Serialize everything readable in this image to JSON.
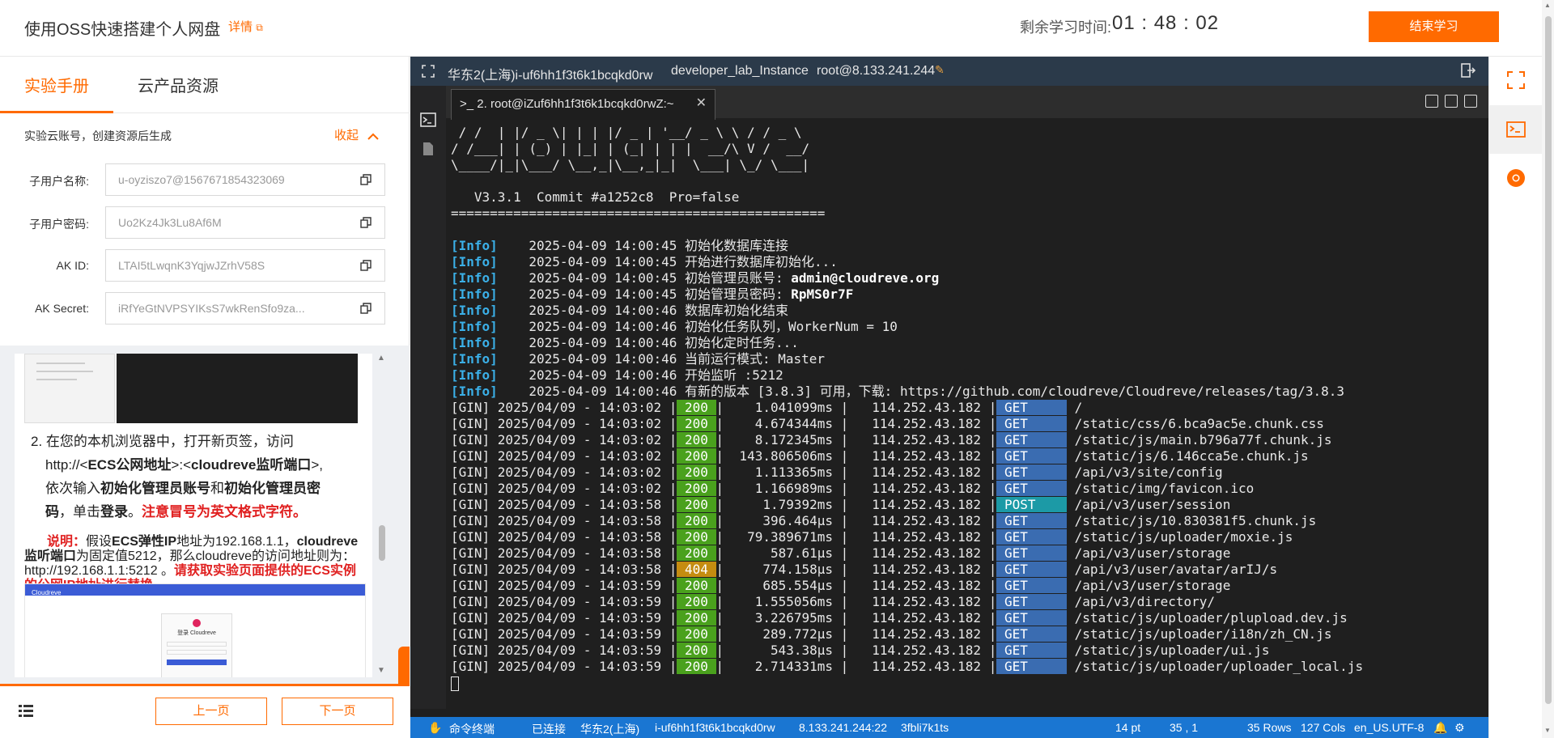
{
  "header": {
    "title": "使用OSS快速搭建个人网盘",
    "detail_link": "详情",
    "time_label": "剩余学习时间:",
    "time_value": "01 : 48 : 02",
    "end_button": "结束学习"
  },
  "left_panel": {
    "tabs": [
      {
        "label": "实验手册",
        "active": true
      },
      {
        "label": "云产品资源",
        "active": false
      }
    ],
    "account_note": "实验云账号，创建资源后生成",
    "collapse_label": "收起",
    "fields": [
      {
        "label": "子用户名称:",
        "value": "u-oyziszo7@1567671854323069"
      },
      {
        "label": "子用户密码:",
        "value": "Uo2Kz4Jk3Lu8Af6M"
      },
      {
        "label": "AK ID:",
        "value": "LTAI5tLwqnK3YqjwJZrhV58S"
      },
      {
        "label": "AK Secret:",
        "value": "iRfYeGtNVPSYIKsS7wkRenSfo9za..."
      }
    ],
    "doc": {
      "step_text_1": "2. 在您的本机浏览器中，打开新页签，访问",
      "step_text_2a": "http://<",
      "step_text_2b": "ECS公网地址",
      "step_text_2c": ">:<",
      "step_text_2d": "cloudreve监听端口",
      "step_text_2e": ">,",
      "step_text_3a": "依次输入",
      "step_text_3b": "初始化管理员账号",
      "step_text_3c": "和",
      "step_text_3d": "初始化管理员密",
      "step_text_4a": "码",
      "step_text_4b": "，单击",
      "step_text_4c": "登录",
      "step_text_4d": "。",
      "step_text_4e": "注意冒号为英文格式字符。",
      "note_label": "说明：",
      "note_text_1": "假设",
      "note_text_2": "ECS弹性IP",
      "note_text_3": "地址为192.168.1.1，",
      "note_text_4": "cloudreve监听端口",
      "note_text_5": "为固定值5212，那么cloudreve的访问地址则为：http://192.168.1.1:5212 。",
      "note_red": "请获取实验页面提供的ECS实例的公网IP地址进行替换。",
      "thumb_brand": "Cloudreve",
      "thumb_card": "登录 Cloudreve"
    },
    "prev_button": "上一页",
    "next_button": "下一页"
  },
  "terminal": {
    "top_bar": {
      "region_instance": "华东2(上海)i-uf6hh1f3t6k1bcqkd0rw",
      "lab_instance": "developer_lab_Instance",
      "login": "root@8.133.241.244"
    },
    "tab_title": ">_ 2. root@iZuf6hh1f3t6k1bcqkd0rwZ:~",
    "banner": [
      " / /  | |/ _ \\| | | |/ _ | '__/ _ \\ \\ / / _ \\",
      "/ /___| | (_) | |_| | (_| | | |  __/\\ V /  __/",
      "\\____/|_|\\___/ \\__,_|\\__,_|_|  \\___| \\_/ \\___|",
      "",
      "   V3.3.1  Commit #a1252c8  Pro=false",
      "================================================",
      ""
    ],
    "info_lines": [
      {
        "tag": "[Info]",
        "time": "2025-04-09 14:00:45",
        "msg": "初始化数据库连接",
        "hl": ""
      },
      {
        "tag": "[Info]",
        "time": "2025-04-09 14:00:45",
        "msg": "开始进行数据库初始化...",
        "hl": ""
      },
      {
        "tag": "[Info]",
        "time": "2025-04-09 14:00:45",
        "msg": "初始管理员账号: ",
        "hl": "admin@cloudreve.org"
      },
      {
        "tag": "[Info]",
        "time": "2025-04-09 14:00:45",
        "msg": "初始管理员密码: ",
        "hl": "RpMS0r7F"
      },
      {
        "tag": "[Info]",
        "time": "2025-04-09 14:00:46",
        "msg": "数据库初始化结束",
        "hl": ""
      },
      {
        "tag": "[Info]",
        "time": "2025-04-09 14:00:46",
        "msg": "初始化任务队列，WorkerNum = 10",
        "hl": ""
      },
      {
        "tag": "[Info]",
        "time": "2025-04-09 14:00:46",
        "msg": "初始化定时任务...",
        "hl": ""
      },
      {
        "tag": "[Info]",
        "time": "2025-04-09 14:00:46",
        "msg": "当前运行模式: Master",
        "hl": ""
      },
      {
        "tag": "[Info]",
        "time": "2025-04-09 14:00:46",
        "msg": "开始监听 :5212",
        "hl": ""
      },
      {
        "tag": "[Info]",
        "time": "2025-04-09 14:00:46",
        "msg": "有新的版本 [3.8.3] 可用，下载: https://github.com/cloudreve/Cloudreve/releases/tag/3.8.3",
        "hl": ""
      }
    ],
    "gin_lines": [
      {
        "date": "2025/04/09 - 14:03:02",
        "status": "200",
        "latency": "1.041099ms",
        "ip": "114.252.43.182",
        "method": "GET",
        "path": "/"
      },
      {
        "date": "2025/04/09 - 14:03:02",
        "status": "200",
        "latency": "4.674344ms",
        "ip": "114.252.43.182",
        "method": "GET",
        "path": "/static/css/6.bca9ac5e.chunk.css"
      },
      {
        "date": "2025/04/09 - 14:03:02",
        "status": "200",
        "latency": "8.172345ms",
        "ip": "114.252.43.182",
        "method": "GET",
        "path": "/static/js/main.b796a77f.chunk.js"
      },
      {
        "date": "2025/04/09 - 14:03:02",
        "status": "200",
        "latency": "143.806506ms",
        "ip": "114.252.43.182",
        "method": "GET",
        "path": "/static/js/6.146cca5e.chunk.js"
      },
      {
        "date": "2025/04/09 - 14:03:02",
        "status": "200",
        "latency": "1.113365ms",
        "ip": "114.252.43.182",
        "method": "GET",
        "path": "/api/v3/site/config"
      },
      {
        "date": "2025/04/09 - 14:03:02",
        "status": "200",
        "latency": "1.166989ms",
        "ip": "114.252.43.182",
        "method": "GET",
        "path": "/static/img/favicon.ico"
      },
      {
        "date": "2025/04/09 - 14:03:58",
        "status": "200",
        "latency": "1.79392ms",
        "ip": "114.252.43.182",
        "method": "POST",
        "path": "/api/v3/user/session"
      },
      {
        "date": "2025/04/09 - 14:03:58",
        "status": "200",
        "latency": "396.464µs",
        "ip": "114.252.43.182",
        "method": "GET",
        "path": "/static/js/10.830381f5.chunk.js"
      },
      {
        "date": "2025/04/09 - 14:03:58",
        "status": "200",
        "latency": "79.389671ms",
        "ip": "114.252.43.182",
        "method": "GET",
        "path": "/static/js/uploader/moxie.js"
      },
      {
        "date": "2025/04/09 - 14:03:58",
        "status": "200",
        "latency": "587.61µs",
        "ip": "114.252.43.182",
        "method": "GET",
        "path": "/api/v3/user/storage"
      },
      {
        "date": "2025/04/09 - 14:03:58",
        "status": "404",
        "latency": "774.158µs",
        "ip": "114.252.43.182",
        "method": "GET",
        "path": "/api/v3/user/avatar/arIJ/s"
      },
      {
        "date": "2025/04/09 - 14:03:59",
        "status": "200",
        "latency": "685.554µs",
        "ip": "114.252.43.182",
        "method": "GET",
        "path": "/api/v3/user/storage"
      },
      {
        "date": "2025/04/09 - 14:03:59",
        "status": "200",
        "latency": "1.555056ms",
        "ip": "114.252.43.182",
        "method": "GET",
        "path": "/api/v3/directory/"
      },
      {
        "date": "2025/04/09 - 14:03:59",
        "status": "200",
        "latency": "3.226795ms",
        "ip": "114.252.43.182",
        "method": "GET",
        "path": "/static/js/uploader/plupload.dev.js"
      },
      {
        "date": "2025/04/09 - 14:03:59",
        "status": "200",
        "latency": "289.772µs",
        "ip": "114.252.43.182",
        "method": "GET",
        "path": "/static/js/uploader/i18n/zh_CN.js"
      },
      {
        "date": "2025/04/09 - 14:03:59",
        "status": "200",
        "latency": "543.38µs",
        "ip": "114.252.43.182",
        "method": "GET",
        "path": "/static/js/uploader/ui.js"
      },
      {
        "date": "2025/04/09 - 14:03:59",
        "status": "200",
        "latency": "2.714331ms",
        "ip": "114.252.43.182",
        "method": "GET",
        "path": "/static/js/uploader/uploader_local.js"
      }
    ],
    "status_bar": {
      "terminal_label": "命令终端",
      "connection": "已连接",
      "region": "华东2(上海)",
      "instance": "i-uf6hh1f3t6k1bcqkd0rw",
      "address": "8.133.241.244:22",
      "session": "3fbli7k1ts",
      "font_size": "14 pt",
      "cursor_pos": "35 , 1",
      "rows": "35 Rows",
      "cols": "127 Cols",
      "encoding": "en_US.UTF-8"
    }
  },
  "colors": {
    "accent": "#ff6a00",
    "status_ok": "#4aa11d",
    "status_404": "#c58c10",
    "method_get": "#3a6cb1",
    "method_post": "#1c9aa6",
    "statusbar": "#1a76d2"
  }
}
